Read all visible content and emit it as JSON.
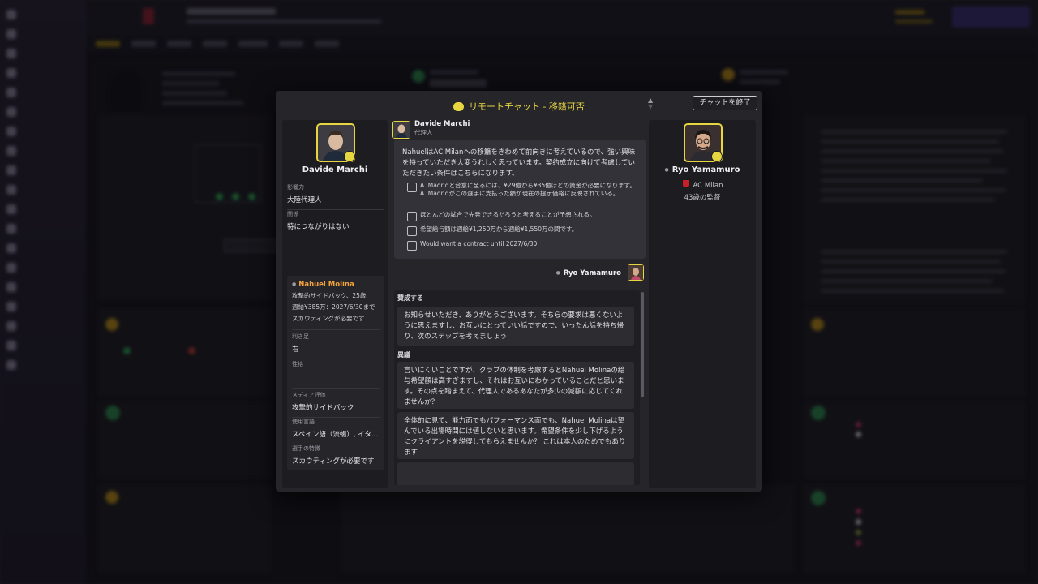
{
  "modal": {
    "title": "リモートチャット - 移籍可否",
    "end_chat_label": "チャットを終了"
  },
  "agent": {
    "name": "Davide Marchi",
    "role": "代理人",
    "fields": [
      {
        "label": "影響力",
        "value": "大陸代理人"
      },
      {
        "label": "関係",
        "value": "特につながりはない"
      }
    ]
  },
  "player": {
    "name": "Nahuel Molina",
    "line1": "攻撃的サイドバック、25歳",
    "line2": "週給¥385万：2027/6/30まで",
    "line3": "スカウティングが必要です",
    "fields": [
      {
        "label": "利き足",
        "value": "右"
      },
      {
        "label": "性格",
        "value": ""
      },
      {
        "label": "メディア評価",
        "value": "攻撃的サイドバック"
      },
      {
        "label": "使用言語",
        "value": "スペイン語（流暢）, イタ..."
      },
      {
        "label": "選手の特徴",
        "value": "スカウティングが必要です"
      }
    ]
  },
  "message": {
    "sender": "Davide Marchi",
    "sender_role": "代理人",
    "body": "NahuelはAC Milanへの移籍をきわめて前向きに考えているので、強い興味を持っていただき大変うれしく思っています。契約成立に向けて考慮していただきたい条件はこちらになります。",
    "conditions": [
      {
        "icon": "money-icon",
        "text": "A. Madridと合意に至るには、¥29億から¥35億ほどの資金が必要になります。A. Madridがこの選手に支払った額が現在の提示価格に反映されている。"
      },
      {
        "icon": "lineup-icon",
        "text": "ほとんどの試合で先発できるだろうと考えることが予想される。"
      },
      {
        "icon": "contract-icon",
        "text": "希望給与額は週給¥1,250万から週給¥1,550万の間です。"
      },
      {
        "icon": "contract-icon",
        "text": "Would want a contract until 2027/6/30."
      }
    ]
  },
  "user": {
    "name": "Ryo Yamamuro",
    "club": "AC Milan",
    "age_label": "43歳の監督"
  },
  "replies": {
    "agree_title": "賛成する",
    "agree_options": [
      "お知らせいただき、ありがとうございます。そちらの要求は悪くないように思えますし、お互いにとっていい話ですので、いったん話を持ち帰り、次のステップを考えましょう"
    ],
    "object_title": "異議",
    "object_options": [
      "言いにくいことですが、クラブの体制を考慮するとNahuel Molinaの給与希望額は高すぎますし、それはお互いにわかっていることだと思います。その点を踏まえて、代理人であるあなたが多少の減額に応じてくれませんか？",
      "全体的に見て、能力面でもパフォーマンス面でも、Nahuel Molinaは望んでいる出場時間には値しないと思います。希望条件を少し下げるようにクライアントを説得してもらえませんか？ これは本人のためでもあります"
    ]
  },
  "colors": {
    "accent": "#e8d641",
    "player_name": "#f2a23a",
    "modal_bg": "#26262a"
  }
}
